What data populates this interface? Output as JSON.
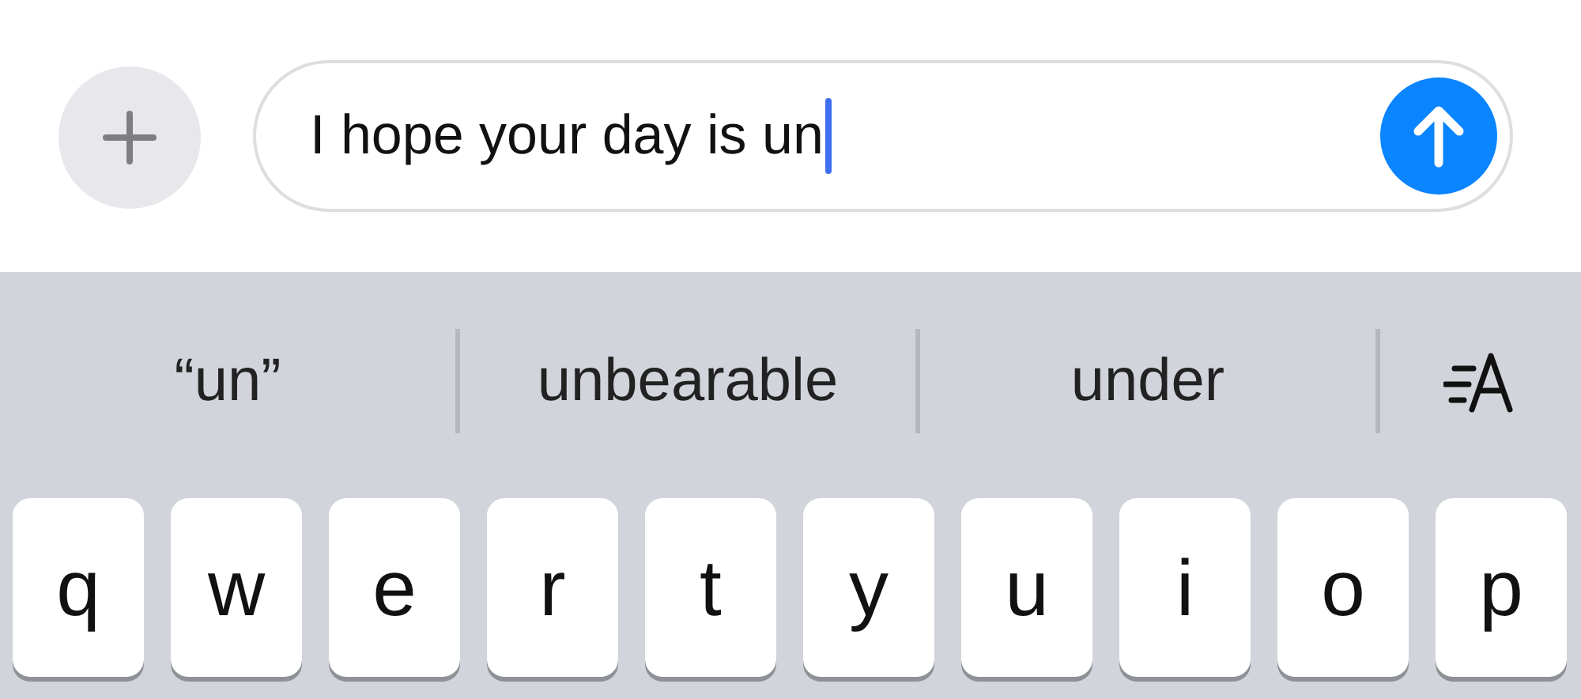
{
  "composer": {
    "message": "I hope your day is un",
    "cursor": true
  },
  "suggestions": [
    {
      "text": "“un”"
    },
    {
      "text": "unbearable"
    },
    {
      "text": "under"
    }
  ],
  "keys": [
    "q",
    "w",
    "e",
    "r",
    "t",
    "y",
    "u",
    "i",
    "o",
    "p"
  ]
}
